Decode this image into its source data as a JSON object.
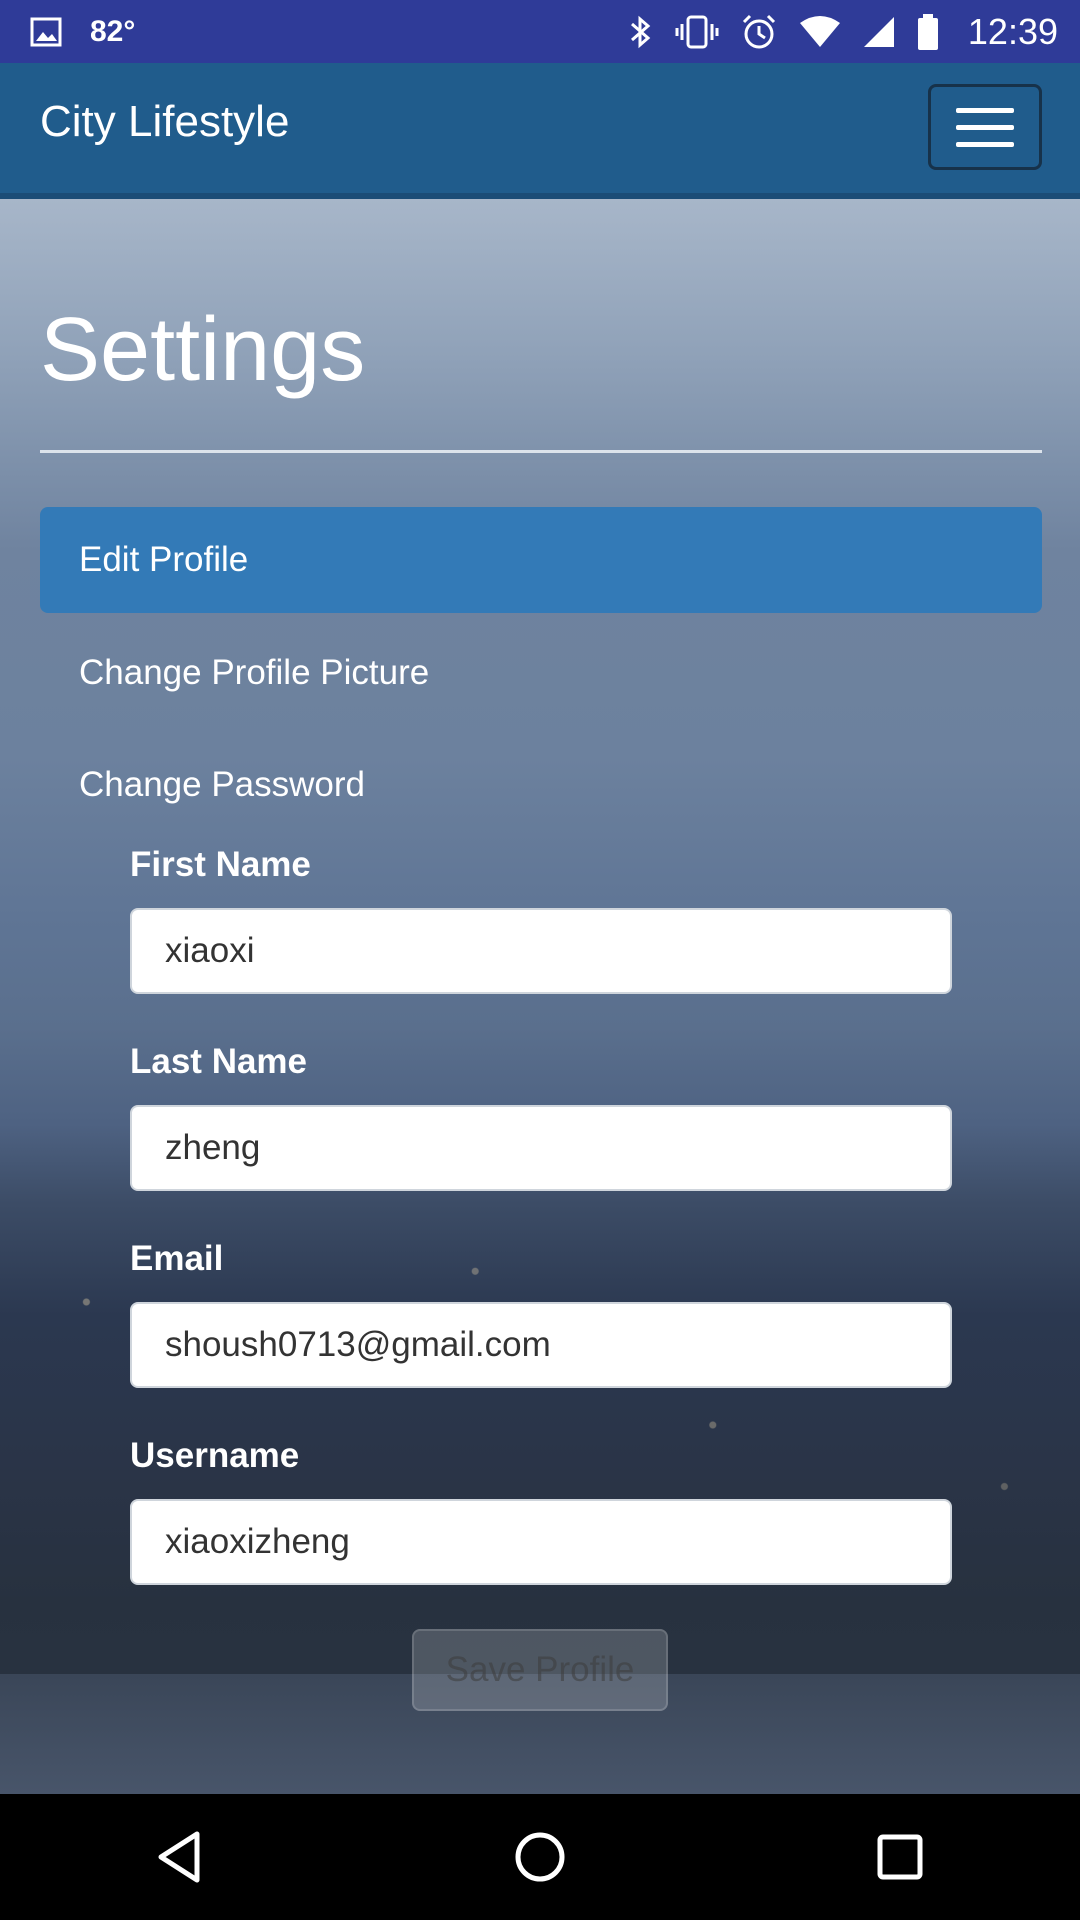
{
  "status_bar": {
    "temperature": "82°",
    "time": "12:39",
    "icons": [
      "image-icon",
      "bluetooth-icon",
      "vibrate-icon",
      "alarm-icon",
      "wifi-icon",
      "signal-icon",
      "battery-icon"
    ]
  },
  "app_bar": {
    "title": "City Lifestyle",
    "menu_icon": "hamburger-menu-icon"
  },
  "page": {
    "title": "Settings",
    "nav": [
      {
        "label": "Edit Profile",
        "active": true
      },
      {
        "label": "Change Profile Picture",
        "active": false
      },
      {
        "label": "Change Password",
        "active": false
      }
    ]
  },
  "form": {
    "first_name": {
      "label": "First Name",
      "value": "xiaoxi"
    },
    "last_name": {
      "label": "Last Name",
      "value": "zheng"
    },
    "email": {
      "label": "Email",
      "value": "shoush0713@gmail.com"
    },
    "username": {
      "label": "Username",
      "value": "xiaoxizheng"
    },
    "save_label": "Save Profile"
  },
  "system_nav": {
    "icons": [
      "back-icon",
      "home-icon",
      "recents-icon"
    ]
  },
  "colors": {
    "status_bar": "#2f3b98",
    "app_bar": "#205c8c",
    "active_nav": "#337ab7"
  }
}
